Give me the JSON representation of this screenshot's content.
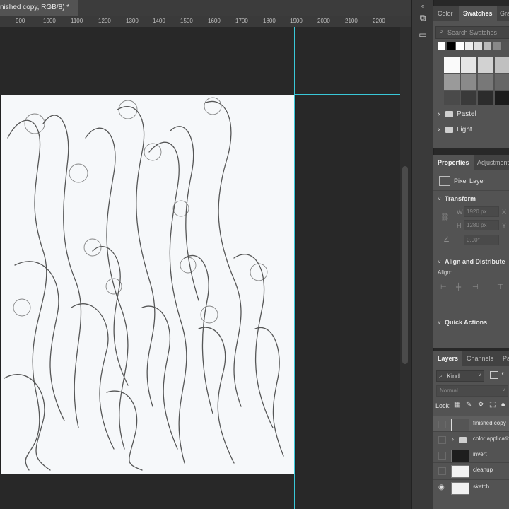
{
  "document": {
    "tab_title": "nished copy, RGB/8) *"
  },
  "ruler": {
    "labels": [
      "900",
      "1000",
      "1100",
      "1200",
      "1300",
      "1400",
      "1500",
      "1600",
      "1700",
      "1800",
      "1900",
      "2000",
      "2100",
      "2200"
    ]
  },
  "swatches_panel": {
    "tabs": [
      "Color",
      "Swatches",
      "Gra"
    ],
    "active_tab": "Swatches",
    "search_placeholder": "Search Swatches",
    "folders": [
      "Pastel",
      "Light"
    ]
  },
  "properties_panel": {
    "tabs": [
      "Properties",
      "Adjustment"
    ],
    "active_tab": "Properties",
    "layer_type": "Pixel Layer",
    "transform": {
      "title": "Transform",
      "w_label": "W",
      "w_value": "1920 px",
      "x_label": "X",
      "h_label": "H",
      "h_value": "1280 px",
      "y_label": "Y",
      "angle_value": "0.00°"
    },
    "align": {
      "title": "Align and Distribute",
      "label": "Align:"
    },
    "quick_actions": {
      "title": "Quick Actions"
    }
  },
  "layers_panel": {
    "tabs": [
      "Layers",
      "Channels",
      "Pa"
    ],
    "active_tab": "Layers",
    "filter_label": "Kind",
    "blend_mode": "Normal",
    "lock_label": "Lock:",
    "layers": [
      {
        "name": "finished copy",
        "visible": false,
        "type": "pixel"
      },
      {
        "name": "color application",
        "visible": false,
        "type": "group"
      },
      {
        "name": "invert",
        "visible": false,
        "type": "pixel-dark"
      },
      {
        "name": "cleanup",
        "visible": false,
        "type": "pixel"
      },
      {
        "name": "sketch",
        "visible": true,
        "type": "pixel"
      }
    ]
  },
  "colors": {
    "guide": "#39c7d8",
    "panel_bg": "#535353",
    "canvas_bg": "#282828"
  }
}
